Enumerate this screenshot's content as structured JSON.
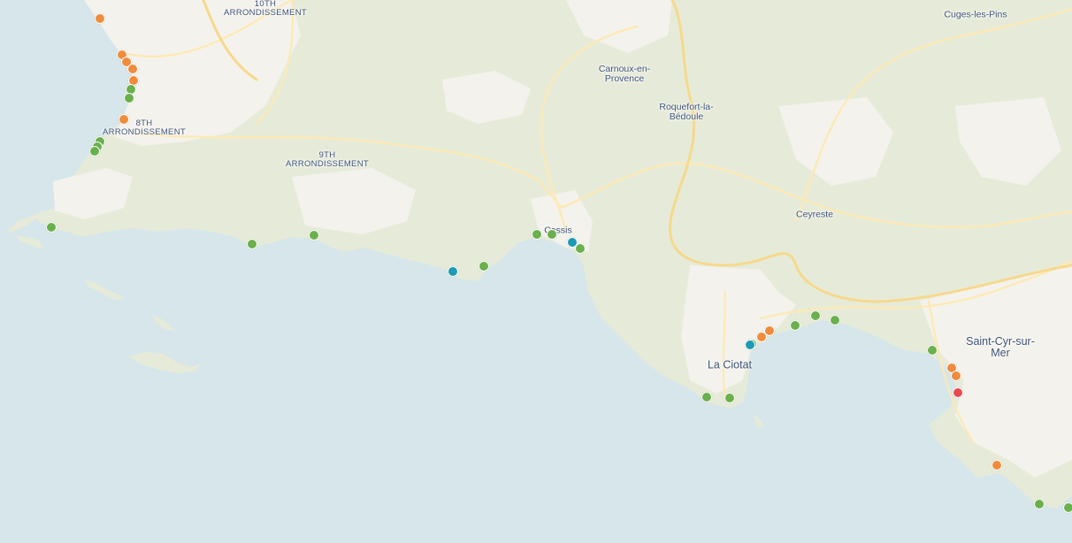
{
  "colors": {
    "sea": "#d6e6ea",
    "land": "#e6ebd9",
    "urban": "#f4f2ec",
    "road": "#fde9b2",
    "highway": "#f6d98c",
    "label": "#3d5273",
    "status": {
      "good": "#6ab04c",
      "average": "#f08c3c",
      "poor": "#e84a4f",
      "excellent": "#1c9bb3"
    }
  },
  "places": [
    {
      "id": "10th-arrondissement",
      "text": "10TH\nARRONDISSEMENT",
      "size": "small"
    },
    {
      "id": "8th-arrondissement",
      "text": "8TH\nARRONDISSEMENT",
      "size": "small"
    },
    {
      "id": "9th-arrondissement",
      "text": "9TH\nARRONDISSEMENT",
      "size": "small"
    },
    {
      "id": "cuges-les-pins",
      "text": "Cuges-les-Pins",
      "size": "mid"
    },
    {
      "id": "carnoux-en-provence",
      "text": "Carnoux-en-\nProvence",
      "size": "mid"
    },
    {
      "id": "roquefort-la-bedoule",
      "text": "Roquefort-la-\nBédoule",
      "size": "mid"
    },
    {
      "id": "ceyreste",
      "text": "Ceyreste",
      "size": "mid"
    },
    {
      "id": "cassis",
      "text": "Cassis",
      "size": "mid"
    },
    {
      "id": "la-ciotat",
      "text": "La Ciotat",
      "size": "big"
    },
    {
      "id": "saint-cyr-sur-mer",
      "text": "Saint-Cyr-sur-\nMer",
      "size": "big"
    }
  ],
  "markers": [
    {
      "status": "average"
    },
    {
      "status": "average"
    },
    {
      "status": "average"
    },
    {
      "status": "average"
    },
    {
      "status": "average"
    },
    {
      "status": "good"
    },
    {
      "status": "good"
    },
    {
      "status": "average"
    },
    {
      "status": "good"
    },
    {
      "status": "good"
    },
    {
      "status": "good"
    },
    {
      "status": "good"
    },
    {
      "status": "good"
    },
    {
      "status": "good"
    },
    {
      "status": "excellent"
    },
    {
      "status": "good"
    },
    {
      "status": "good"
    },
    {
      "status": "good"
    },
    {
      "status": "excellent"
    },
    {
      "status": "good"
    },
    {
      "status": "good"
    },
    {
      "status": "good"
    },
    {
      "status": "good"
    },
    {
      "status": "average"
    },
    {
      "status": "average"
    },
    {
      "status": "good"
    },
    {
      "status": "good"
    },
    {
      "status": "good"
    },
    {
      "status": "good"
    },
    {
      "status": "average"
    },
    {
      "status": "average"
    },
    {
      "status": "poor"
    },
    {
      "status": "average"
    },
    {
      "status": "good"
    },
    {
      "status": "good"
    },
    {
      "status": "excellent"
    }
  ]
}
